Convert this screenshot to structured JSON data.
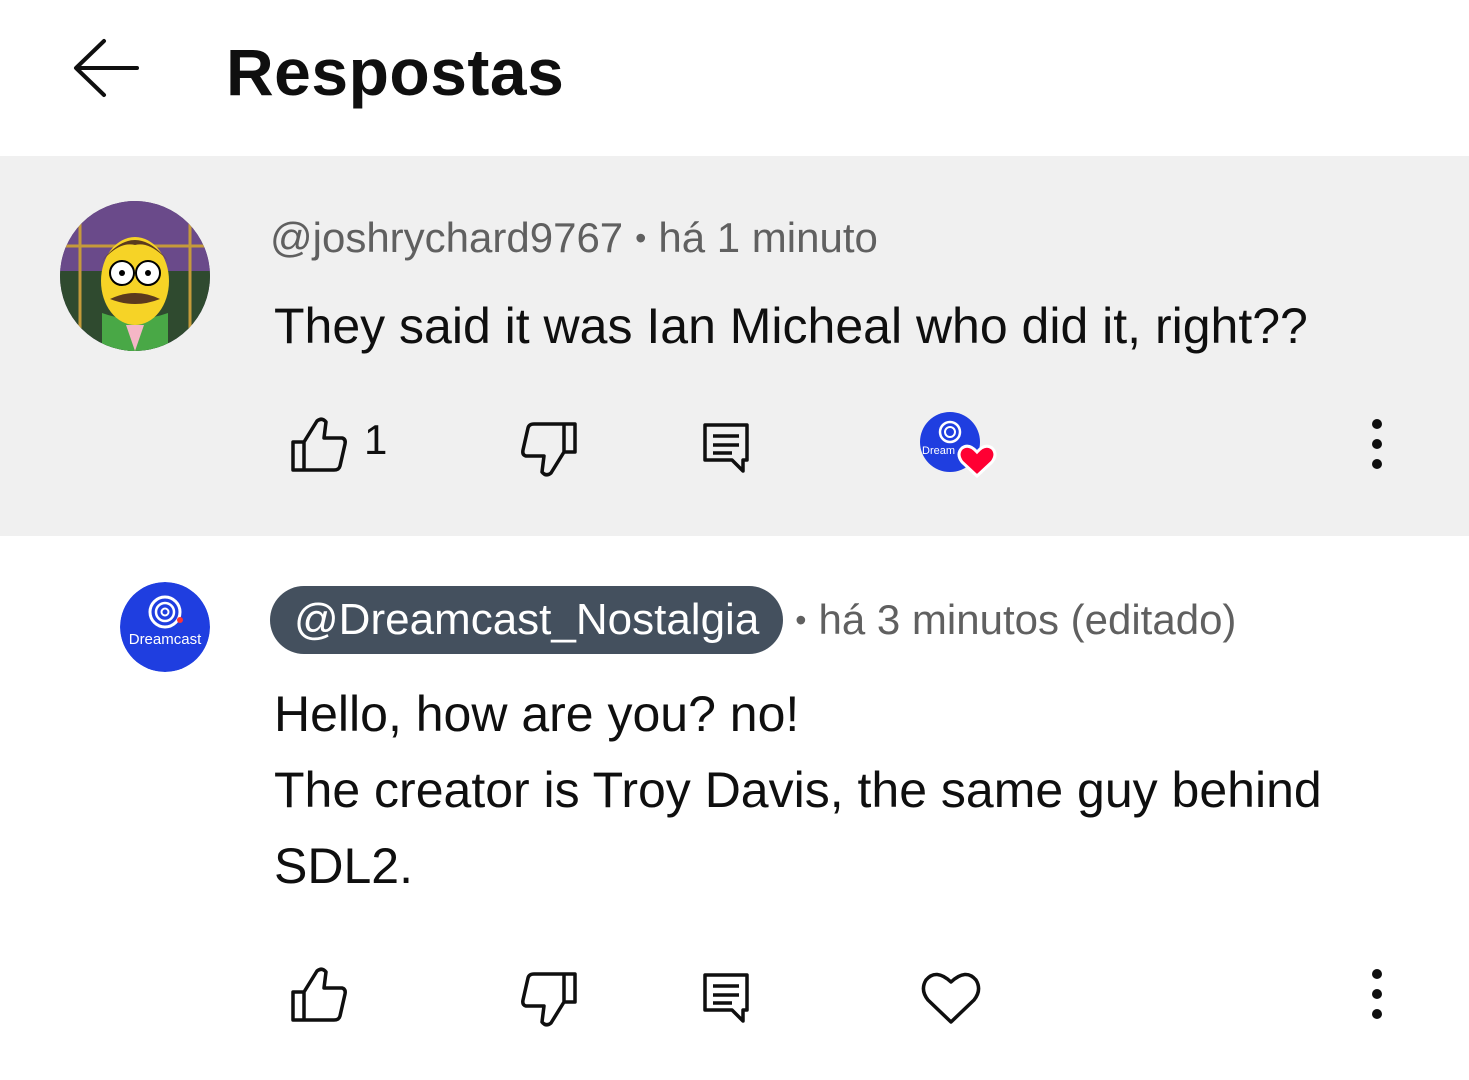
{
  "header": {
    "back_icon": "arrow-left-icon",
    "title": "Respostas"
  },
  "comments": [
    {
      "author": "@joshrychard9767",
      "time": "há 1 minuto",
      "lines": [
        "They said it was Ian Micheal who did it, right??"
      ],
      "like_count": "1",
      "avatar_icon": "cartoon-avatar",
      "creator_heart": true,
      "creator_heart_avatar_text": "Dream",
      "heart_color": "#ff0033"
    },
    {
      "author": "@Dreamcast_Nostalgia",
      "time": "há 3 minutos (editado)",
      "lines": [
        "Hello, how are you? no!",
        "The creator is Troy Davis, the same guy behind",
        "SDL2."
      ],
      "like_count": "",
      "avatar_text": "Dreamcast",
      "avatar_color": "#1f3ee0",
      "author_pill_color": "#44505e"
    }
  ],
  "icons": {
    "like": "thumb-up-icon",
    "dislike": "thumb-down-icon",
    "reply": "comment-icon",
    "heart": "heart-icon",
    "more": "more-vert-icon"
  }
}
